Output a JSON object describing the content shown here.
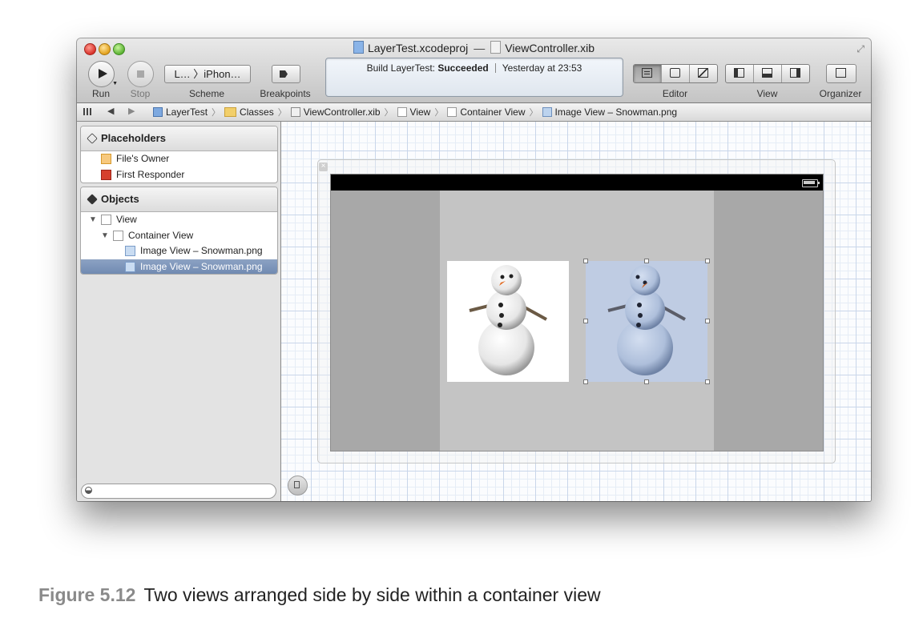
{
  "window": {
    "title_project": "LayerTest.xcodeproj",
    "title_separator": "—",
    "title_file": "ViewController.xib"
  },
  "toolbar": {
    "run_label": "Run",
    "stop_label": "Stop",
    "scheme_value": "L… 〉iPhon…",
    "scheme_label": "Scheme",
    "breakpoints_label": "Breakpoints",
    "editor_label": "Editor",
    "view_label": "View",
    "organizer_label": "Organizer"
  },
  "activity": {
    "prefix": "Build LayerTest: ",
    "status": "Succeeded",
    "time": "Yesterday at 23:53"
  },
  "jumpbar": {
    "nav_back": "◀",
    "nav_forward": "▶",
    "crumbs": [
      "LayerTest",
      "Classes",
      "ViewController.xib",
      "View",
      "Container View",
      "Image View – Snowman.png"
    ]
  },
  "placeholders": {
    "title": "Placeholders",
    "items": [
      "File's Owner",
      "First Responder"
    ]
  },
  "objects": {
    "title": "Objects",
    "items": [
      "View",
      "Container View",
      "Image View – Snowman.png",
      "Image View – Snowman.png"
    ]
  },
  "colors": {
    "selection": "#7a92b8",
    "container_bg": "#c4c4c4",
    "device_bg": "#a8a8a8",
    "selected_image_tint": "#bfcce3"
  },
  "caption": {
    "figure": "Figure 5.12",
    "text": "Two views arranged side by side within a container view"
  }
}
